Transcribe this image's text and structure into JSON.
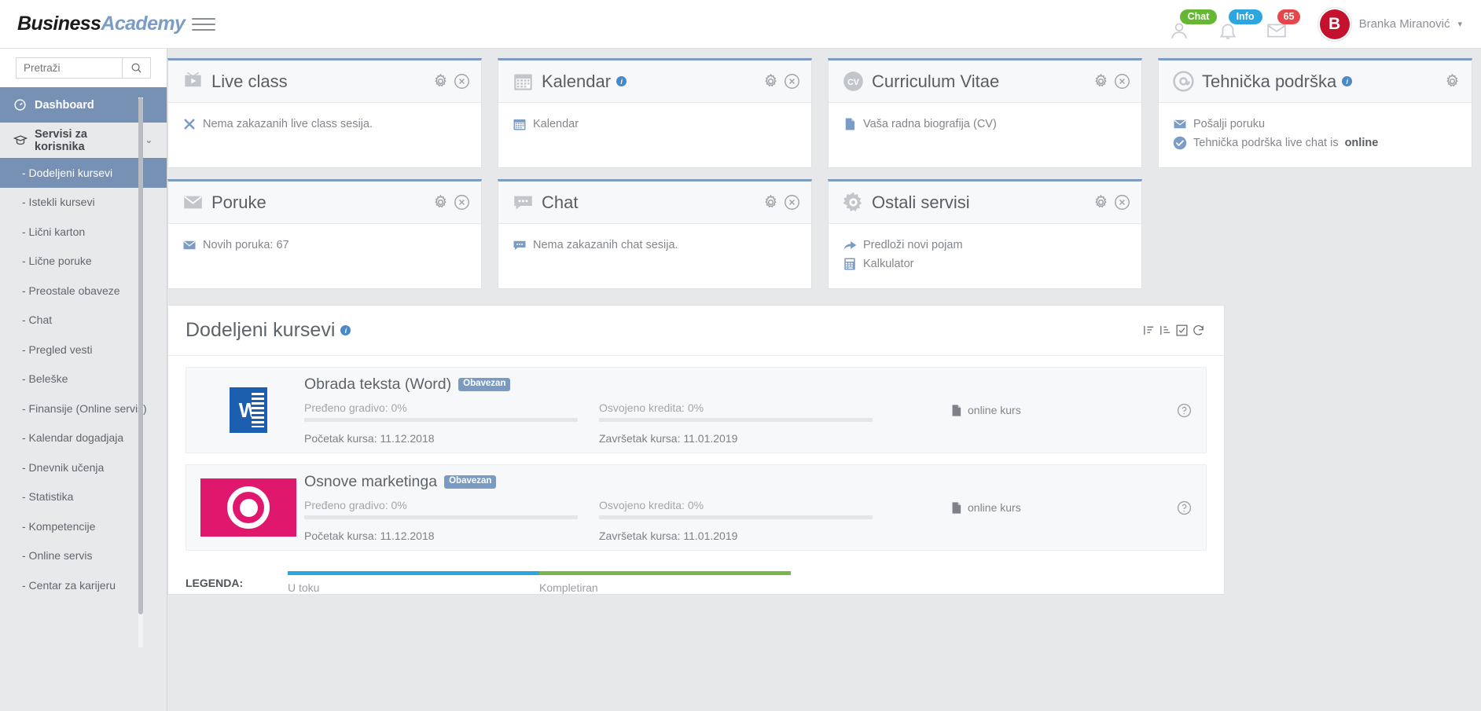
{
  "brand": {
    "part1": "Business",
    "part2": "Academy"
  },
  "topbar": {
    "menu_icon": "hamburger-icon",
    "notifications": [
      {
        "icon": "user-icon",
        "badge": "Chat",
        "color": "#66b834"
      },
      {
        "icon": "bell-icon",
        "badge": "Info",
        "color": "#2ba6e0"
      },
      {
        "icon": "envelope-icon",
        "badge": "65",
        "color": "#e8454a"
      }
    ],
    "avatar_letter": "B",
    "username": "Branka Miranović",
    "caret": "▾"
  },
  "sidebar": {
    "search": {
      "placeholder": "Pretraži",
      "value": "",
      "icon": "search-icon"
    },
    "dashboard": {
      "label": "Dashboard",
      "icon": "dashboard-icon"
    },
    "group": {
      "label": "Servisi za korisnika",
      "icon": "graduation-cap-icon",
      "chevron": "⌄"
    },
    "items": [
      {
        "label": "- Dodeljeni kursevi",
        "active": true
      },
      {
        "label": "- Istekli kursevi"
      },
      {
        "label": "- Lični karton"
      },
      {
        "label": "- Lične poruke"
      },
      {
        "label": "- Preostale obaveze"
      },
      {
        "label": "- Chat"
      },
      {
        "label": "- Pregled vesti"
      },
      {
        "label": "- Beleške"
      },
      {
        "label": "- Finansije (Online servis)"
      },
      {
        "label": "- Kalendar dogadjaja"
      },
      {
        "label": "- Dnevnik učenja"
      },
      {
        "label": "- Statistika"
      },
      {
        "label": "- Kompetencije"
      },
      {
        "label": "- Online servis"
      },
      {
        "label": "- Centar za karijeru"
      }
    ]
  },
  "cards": [
    {
      "title": "Live class",
      "icon": "tv-icon",
      "has_info": false,
      "gear": true,
      "close": true,
      "lines": [
        {
          "icon": "x-mark-icon",
          "text": "Nema zakazanih live class sesija."
        }
      ]
    },
    {
      "title": "Kalendar",
      "icon": "calendar-icon",
      "has_info": true,
      "gear": true,
      "close": true,
      "lines": [
        {
          "icon": "calendar-icon",
          "text": "Kalendar"
        }
      ]
    },
    {
      "title": "Curriculum Vitae",
      "icon": "cv-icon",
      "has_info": false,
      "gear": true,
      "close": true,
      "lines": [
        {
          "icon": "document-icon",
          "text": "Vaša radna biografija (CV)"
        }
      ]
    },
    {
      "title": "Tehnička podrška",
      "icon": "at-sign-icon",
      "has_info": true,
      "gear": true,
      "close": false,
      "lines": [
        {
          "icon": "envelope-icon",
          "text": "Pošalji poruku"
        },
        {
          "icon": "check-circle-icon",
          "text": "Tehnička podrška live chat is ",
          "bold": "online"
        }
      ]
    },
    {
      "title": "Poruke",
      "icon": "envelope-icon",
      "has_info": false,
      "gear": true,
      "close": true,
      "lines": [
        {
          "icon": "envelope-icon",
          "text": "Novih poruka: 67"
        }
      ]
    },
    {
      "title": "Chat",
      "icon": "chat-bubble-icon",
      "has_info": false,
      "gear": true,
      "close": true,
      "lines": [
        {
          "icon": "chat-bubble-icon",
          "text": "Nema zakazanih chat sesija."
        }
      ]
    },
    {
      "title": "Ostali servisi",
      "icon": "gear-icon",
      "has_info": false,
      "gear": true,
      "close": true,
      "lines": [
        {
          "icon": "arrow-share-icon",
          "text": "Predloži novi pojam"
        },
        {
          "icon": "calculator-icon",
          "text": "Kalkulator"
        }
      ]
    }
  ],
  "panel": {
    "title": "Dodeljeni kursevi",
    "info": "i",
    "tools": [
      "sort-numeric-icon",
      "sort-alpha-icon",
      "checkbox-icon",
      "refresh-icon"
    ],
    "courses": [
      {
        "thumb": "word-icon",
        "name": "Obrada teksta (Word)",
        "tag": "Obavezan",
        "progress_label": "Pređeno gradivo: 0%",
        "progress_value": 0,
        "credits_label": "Osvojeno kredita: 0%",
        "credits_value": 0,
        "start_label": "Početak kursa: 11.12.2018",
        "end_label": "Završetak kursa: 11.01.2019",
        "type_label": "online kurs",
        "type_icon": "document-icon",
        "help_icon": "question-mark-icon"
      },
      {
        "thumb": "marketing-icon",
        "name": "Osnove marketinga",
        "tag": "Obavezan",
        "progress_label": "Pređeno gradivo: 0%",
        "progress_value": 0,
        "credits_label": "Osvojeno kredita: 0%",
        "credits_value": 0,
        "start_label": "Početak kursa: 11.12.2018",
        "end_label": "Završetak kursa: 11.01.2019",
        "type_label": "online kurs",
        "type_icon": "document-icon",
        "help_icon": "question-mark-icon"
      }
    ],
    "legend": {
      "label": "LEGENDA:",
      "items": [
        {
          "text": "U toku",
          "color": "#29a7df"
        },
        {
          "text": "Kompletiran",
          "color": "#7ab648"
        }
      ]
    }
  }
}
